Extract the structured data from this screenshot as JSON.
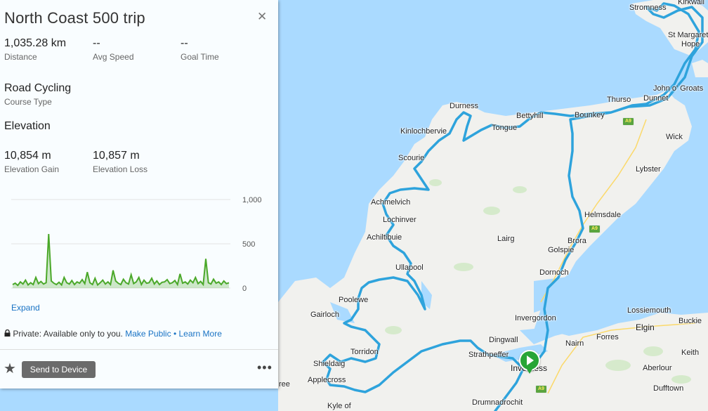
{
  "panel": {
    "title": "North Coast 500 trip",
    "close_icon": "close-icon",
    "stats": [
      {
        "value": "1,035.28 km",
        "label": "Distance"
      },
      {
        "value": "--",
        "label": "Avg Speed"
      },
      {
        "value": "--",
        "label": "Goal Time"
      }
    ],
    "course_type": {
      "value": "Road Cycling",
      "label": "Course Type"
    },
    "elevation_heading": "Elevation",
    "elevation": [
      {
        "value": "10,854 m",
        "label": "Elevation Gain"
      },
      {
        "value": "10,857 m",
        "label": "Elevation Loss"
      }
    ],
    "expand_label": "Expand",
    "privacy": {
      "lock_icon": "lock-icon",
      "text": "Private: Available only to you.",
      "make_public": "Make Public",
      "separator": "•",
      "learn_more": "Learn More"
    },
    "footer": {
      "star_icon": "star-icon",
      "send_label": "Send to Device",
      "more_icon": "more-icon",
      "more_label": "•••"
    }
  },
  "chart_data": {
    "type": "area",
    "title": "",
    "xlabel": "",
    "ylabel": "",
    "ylim": [
      0,
      1000
    ],
    "yticks": [
      "1,000",
      "500",
      "0"
    ],
    "grid": true,
    "color": "#4aa829",
    "series": [
      {
        "values": [
          40,
          55,
          30,
          70,
          45,
          90,
          35,
          60,
          40,
          120,
          50,
          75,
          45,
          60,
          610,
          80,
          55,
          40,
          65,
          35,
          120,
          60,
          45,
          85,
          40,
          70,
          55,
          95,
          50,
          180,
          60,
          40,
          110,
          35,
          60,
          90,
          45,
          70,
          40,
          200,
          80,
          55,
          40,
          100,
          60,
          45,
          150,
          50,
          70,
          120,
          40,
          90,
          55,
          60,
          110,
          45,
          80,
          40,
          65,
          70,
          95,
          50,
          60,
          85,
          40,
          160,
          55,
          70,
          45,
          90,
          60,
          120,
          50,
          75,
          40,
          330,
          60,
          45,
          100,
          55,
          70,
          40,
          80,
          50,
          60
        ]
      }
    ]
  },
  "map": {
    "labels": [
      {
        "text": "Kirkwall",
        "cls": "town"
      },
      {
        "text": "Stromness",
        "cls": "town"
      },
      {
        "text": "St Margaret's",
        "cls": "town"
      },
      {
        "text": "Hope",
        "cls": "town"
      },
      {
        "text": "John o' Groats",
        "cls": "town"
      },
      {
        "text": "Thurso",
        "cls": "town"
      },
      {
        "text": "Dunnet",
        "cls": "town"
      },
      {
        "text": "Durness",
        "cls": "town"
      },
      {
        "text": "Bettyhill",
        "cls": "town"
      },
      {
        "text": "Bounkey",
        "cls": "town"
      },
      {
        "text": "Tongue",
        "cls": "town"
      },
      {
        "text": "Wick",
        "cls": "town"
      },
      {
        "text": "Kinlochbervie",
        "cls": "town"
      },
      {
        "text": "Scourie",
        "cls": "town"
      },
      {
        "text": "Lybster",
        "cls": "town"
      },
      {
        "text": "Achmelvich",
        "cls": "town"
      },
      {
        "text": "Lochinver",
        "cls": "town"
      },
      {
        "text": "Helmsdale",
        "cls": "town"
      },
      {
        "text": "Achiltibuie",
        "cls": "town"
      },
      {
        "text": "Lairg",
        "cls": "town"
      },
      {
        "text": "Brora",
        "cls": "town"
      },
      {
        "text": "Golspie",
        "cls": "town"
      },
      {
        "text": "Ullapool",
        "cls": "town"
      },
      {
        "text": "Dornoch",
        "cls": "town"
      },
      {
        "text": "Poolewe",
        "cls": "town"
      },
      {
        "text": "Gairloch",
        "cls": "town"
      },
      {
        "text": "Invergordon",
        "cls": "town"
      },
      {
        "text": "Lossiemouth",
        "cls": "town"
      },
      {
        "text": "Elgin",
        "cls": "city"
      },
      {
        "text": "Buckie",
        "cls": "town"
      },
      {
        "text": "Torridon",
        "cls": "town"
      },
      {
        "text": "Dingwall",
        "cls": "town"
      },
      {
        "text": "Nairn",
        "cls": "town"
      },
      {
        "text": "Forres",
        "cls": "town"
      },
      {
        "text": "Keith",
        "cls": "town"
      },
      {
        "text": "Shieldaig",
        "cls": "town"
      },
      {
        "text": "Strathpeffer",
        "cls": "town"
      },
      {
        "text": "Inverness",
        "cls": "city"
      },
      {
        "text": "Aberlour",
        "cls": "town"
      },
      {
        "text": "Applecross",
        "cls": "town"
      },
      {
        "text": "Dufftown",
        "cls": "town"
      },
      {
        "text": "Drumnadrochit",
        "cls": "town"
      },
      {
        "text": "Kyle of",
        "cls": "town"
      },
      {
        "text": "ree",
        "cls": "town"
      }
    ],
    "shields": [
      "A9",
      "A9",
      "A9"
    ],
    "start_icon": "start-flag-icon"
  }
}
